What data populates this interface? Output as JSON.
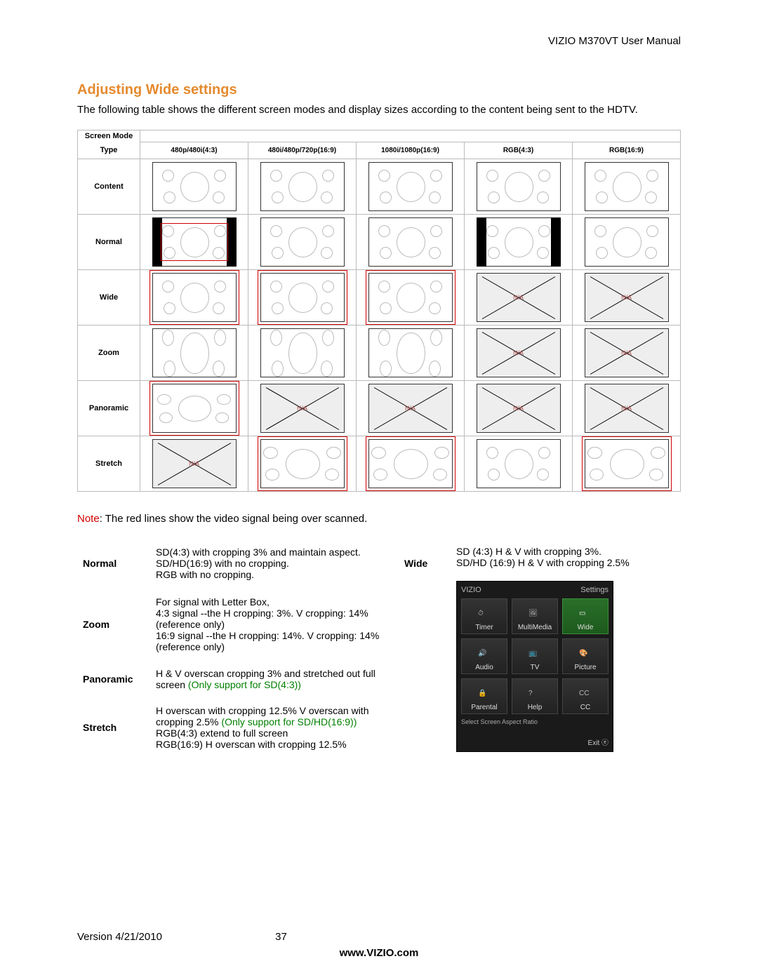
{
  "header": {
    "doc_title": "VIZIO M370VT User Manual"
  },
  "section": {
    "title": "Adjusting Wide settings",
    "intro": "The following table shows the different screen modes and display sizes according to the content being sent to the HDTV."
  },
  "big_table": {
    "corner_top": "Screen Mode",
    "corner_bottom": "Type",
    "cols": [
      "480p/480i(4:3)",
      "480i/480p/720p(16:9)",
      "1080i/1080p(16:9)",
      "RGB(4:3)",
      "RGB(16:9)"
    ],
    "rows": [
      "Content",
      "Normal",
      "Wide",
      "Zoom",
      "Panoramic",
      "Stretch"
    ],
    "na_label": "N/A"
  },
  "note": {
    "word": "Note",
    "text": ": The red lines show the video signal being over scanned."
  },
  "desc": {
    "normal": {
      "label": "Normal",
      "text": "SD(4:3) with cropping 3% and maintain aspect.\nSD/HD(16:9) with no cropping.\nRGB with no cropping."
    },
    "zoom": {
      "label": "Zoom",
      "text": "For signal with Letter Box,\n4:3 signal --the  H cropping: 3%. V cropping: 14% (reference only)\n16:9 signal --the  H cropping: 14%. V cropping: 14% (reference only)"
    },
    "panoramic": {
      "label": "Panoramic",
      "text_pre": "H & V overscan cropping 3% and stretched out full screen",
      "text_green": "(Only support for SD(4:3))"
    },
    "stretch": {
      "label": "Stretch",
      "text_pre": "H overscan with cropping 12.5% V overscan with cropping 2.5%",
      "text_green": "(Only support for SD/HD(16:9))",
      "text_post": "RGB(4:3) extend to full screen\nRGB(16:9) H overscan with cropping 12.5%"
    },
    "wide": {
      "label": "Wide",
      "text": "SD (4:3) H & V with cropping 3%.\nSD/HD (16:9) H & V with cropping 2.5%"
    }
  },
  "osd": {
    "brand": "VIZIO",
    "top_right": "Settings",
    "items": [
      {
        "label": "Timer"
      },
      {
        "label": "MultiMedia"
      },
      {
        "label": "Wide",
        "selected": true
      },
      {
        "label": "Audio"
      },
      {
        "label": "TV"
      },
      {
        "label": "Picture"
      },
      {
        "label": "Parental"
      },
      {
        "label": "Help"
      },
      {
        "label": "CC"
      }
    ],
    "subtitle": "Select Screen Aspect Ratio",
    "exit": "Exit ⓔ"
  },
  "footer": {
    "version": "Version 4/21/2010",
    "page": "37",
    "site": "www.VIZIO.com"
  }
}
